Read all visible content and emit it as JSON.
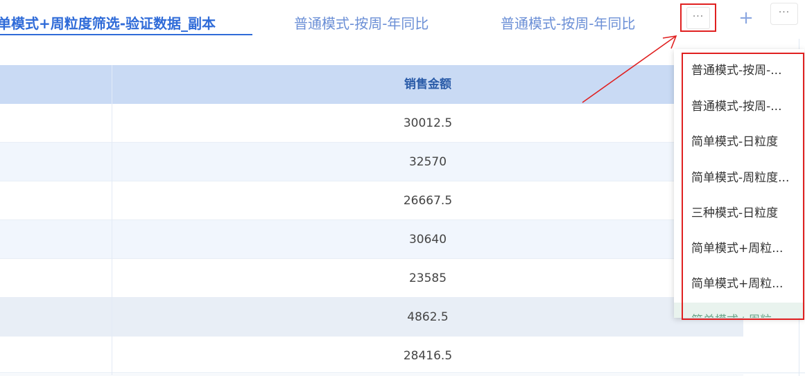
{
  "tabs": {
    "active": "单模式+周粒度筛选-验证数据_副本",
    "tab2": "普通模式-按周-年同比",
    "tab3": "普通模式-按周-年同比",
    "more_label": "···",
    "add_label": "+",
    "more2_label": "···"
  },
  "table": {
    "column_header": "销售金额",
    "rows": [
      "30012.5",
      "32570",
      "26667.5",
      "30640",
      "23585",
      "4862.5",
      "28416.5"
    ]
  },
  "dropdown": {
    "items": [
      "普通模式-按周-...",
      "普通模式-按周-...",
      "简单模式-日粒度",
      "简单模式-周粒度...",
      "三种模式-日粒度",
      "简单模式+周粒...",
      "简单模式+周粒...",
      "简单模式+周粒..."
    ]
  },
  "colors": {
    "accent": "#2f6bd8",
    "header_bg": "#c9daf4",
    "annotation_red": "#e02020"
  }
}
